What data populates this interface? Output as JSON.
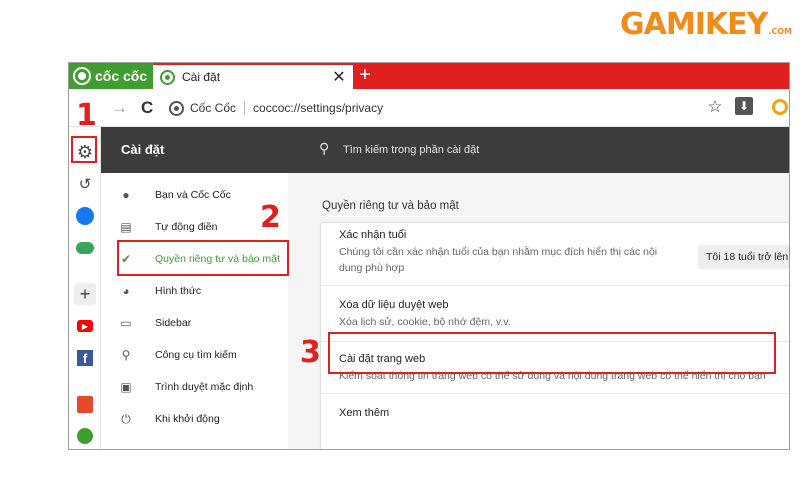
{
  "watermark": {
    "main": "GAMIKEY",
    "suffix": ".COM"
  },
  "browser": {
    "brand_name": "cốc cốc",
    "tab": {
      "title": "Cài đặt",
      "close_symbol": "✕"
    },
    "new_tab_symbol": "+",
    "toolbar": {
      "forward_symbol": "→",
      "reload_symbol": "C",
      "site_name": "Cốc Cốc",
      "url": "coccoc://settings/privacy",
      "bookmark_symbol": "☆",
      "download_symbol": "⬇"
    },
    "sidebar_icons": [
      "gear-icon",
      "history-icon",
      "messenger-icon",
      "gamepad-icon",
      "add-icon",
      "youtube-icon",
      "facebook-icon",
      "calendar-icon",
      "coccoc-icon"
    ],
    "sidebar_glyphs": {
      "gear": "⚙",
      "history": "↺",
      "plus": "+",
      "youtube": "▶",
      "facebook": "f"
    }
  },
  "settings": {
    "header_title": "Cài đặt",
    "search_placeholder": "Tìm kiếm trong phần cài đặt",
    "menu": [
      {
        "label": "Bạn và Cốc Cốc",
        "icon": "person-icon",
        "glyph": "●"
      },
      {
        "label": "Tự động điền",
        "icon": "clipboard-icon",
        "glyph": "▤"
      },
      {
        "label": "Quyền riêng tư và bảo mật",
        "icon": "shield-icon",
        "glyph": "✔",
        "active": true
      },
      {
        "label": "Hình thức",
        "icon": "palette-icon",
        "glyph": "◕"
      },
      {
        "label": "Sidebar",
        "icon": "sidebar-icon",
        "glyph": "▭"
      },
      {
        "label": "Công cụ tìm kiếm",
        "icon": "search-icon",
        "glyph": "⚲"
      },
      {
        "label": "Trình duyệt mặc định",
        "icon": "browser-icon",
        "glyph": "▣"
      },
      {
        "label": "Khi khởi động",
        "icon": "power-icon",
        "glyph": "⏻"
      }
    ],
    "section_title": "Quyền riêng tư và bảo mật",
    "rows": {
      "age": {
        "title": "Xác nhận tuổi",
        "desc_line1": "Chúng tôi cần xác nhận tuổi của bạn nhằm mục đích hiển thị các nội",
        "desc_line2": "dung phù hợp",
        "button": "Tôi 18 tuổi trở lên"
      },
      "clear": {
        "title": "Xóa dữ liệu duyệt web",
        "desc": "Xóa lịch sử, cookie, bộ nhớ đệm, v.v."
      },
      "site_settings": {
        "title": "Cài đặt trang web",
        "desc": "Kiểm soát thông tin trang web có thể sử dụng và nội dung trang web có thể hiển thị cho bạn"
      },
      "more": {
        "title": "Xem thêm"
      }
    }
  },
  "annotations": {
    "step1": "1",
    "step2": "2",
    "step3": "3"
  },
  "colors": {
    "accent_red": "#e0201e",
    "brand_green": "#3f9e2f",
    "header_dark": "#3c3c3c",
    "logo_orange": "#f28b1a"
  }
}
